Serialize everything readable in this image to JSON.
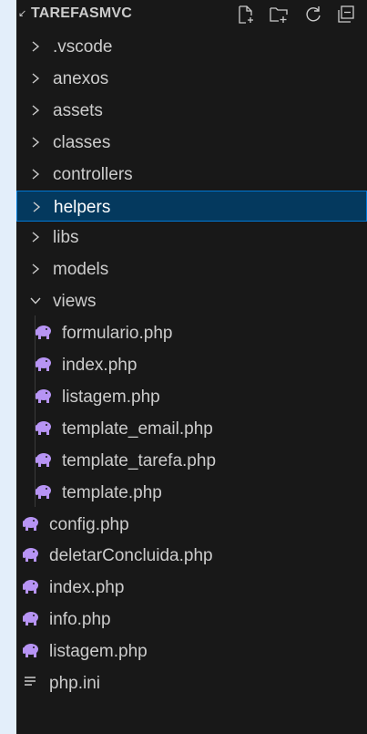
{
  "explorer": {
    "title": "TAREFASMVC",
    "actions": [
      "new-file-icon",
      "new-folder-icon",
      "refresh-icon",
      "collapse-all-icon"
    ]
  },
  "tree": [
    {
      "label": ".vscode",
      "kind": "folder",
      "expanded": false,
      "depth": 0
    },
    {
      "label": "anexos",
      "kind": "folder",
      "expanded": false,
      "depth": 0
    },
    {
      "label": "assets",
      "kind": "folder",
      "expanded": false,
      "depth": 0
    },
    {
      "label": "classes",
      "kind": "folder",
      "expanded": false,
      "depth": 0
    },
    {
      "label": "controllers",
      "kind": "folder",
      "expanded": false,
      "depth": 0
    },
    {
      "label": "helpers",
      "kind": "folder",
      "expanded": false,
      "depth": 0,
      "selected": true
    },
    {
      "label": "libs",
      "kind": "folder",
      "expanded": false,
      "depth": 0
    },
    {
      "label": "models",
      "kind": "folder",
      "expanded": false,
      "depth": 0
    },
    {
      "label": "views",
      "kind": "folder",
      "expanded": true,
      "depth": 0
    },
    {
      "label": "formulario.php",
      "kind": "php",
      "depth": 1
    },
    {
      "label": "index.php",
      "kind": "php",
      "depth": 1
    },
    {
      "label": "listagem.php",
      "kind": "php",
      "depth": 1
    },
    {
      "label": "template_email.php",
      "kind": "php",
      "depth": 1
    },
    {
      "label": "template_tarefa.php",
      "kind": "php",
      "depth": 1
    },
    {
      "label": "template.php",
      "kind": "php",
      "depth": 1
    },
    {
      "label": "config.php",
      "kind": "php",
      "depth": 0
    },
    {
      "label": "deletarConcluida.php",
      "kind": "php",
      "depth": 0
    },
    {
      "label": "index.php",
      "kind": "php",
      "depth": 0
    },
    {
      "label": "info.php",
      "kind": "php",
      "depth": 0
    },
    {
      "label": "listagem.php",
      "kind": "php",
      "depth": 0
    },
    {
      "label": "php.ini",
      "kind": "ini",
      "depth": 0
    }
  ],
  "colors": {
    "panel": "#181818",
    "text": "#cccccc",
    "selection": "#04395e",
    "selection_border": "#0078d4",
    "php_icon": "#b794f4"
  }
}
